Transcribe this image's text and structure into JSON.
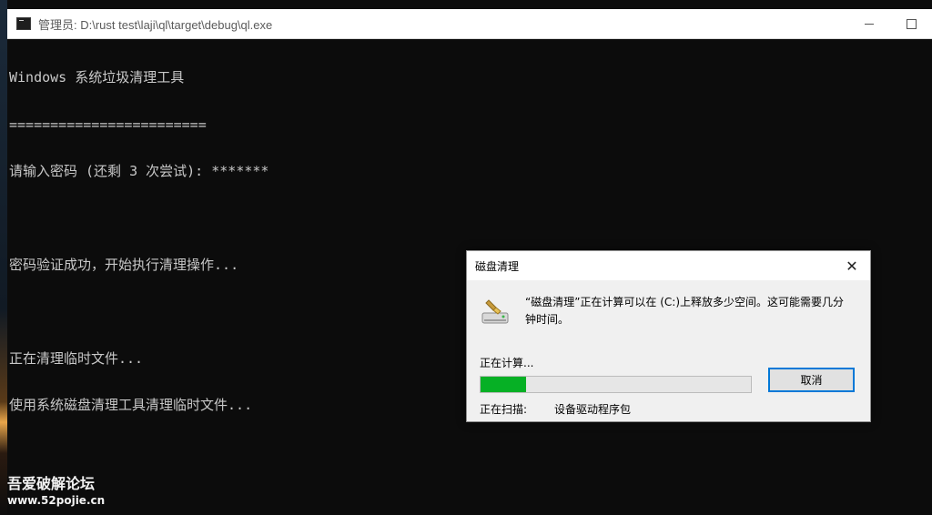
{
  "console": {
    "title": "管理员: D:\\rust test\\laji\\ql\\target\\debug\\ql.exe",
    "lines": [
      "Windows 系统垃圾清理工具",
      "========================",
      "请输入密码 (还剩 3 次尝试): *******",
      "",
      "密码验证成功，开始执行清理操作...",
      "",
      "正在清理临时文件...",
      "使用系统磁盘清理工具清理临时文件..."
    ]
  },
  "dialog": {
    "title": "磁盘清理",
    "close_glyph": "✕",
    "message": "“磁盘清理”正在计算可以在 (C:)上释放多少空间。这可能需要几分钟时间。",
    "status": "正在计算...",
    "progress": 0.17,
    "cancel_label": "取消",
    "scan_label": "正在扫描:",
    "scan_value": "设备驱动程序包",
    "progress_color": "#06b025",
    "focus_color": "#0078d7"
  },
  "watermark": {
    "title": "吾爱破解论坛",
    "url": "www.52pojie.cn"
  },
  "icons": {
    "console_icon": "console-app-icon",
    "dialog_icon": "disk-cleanup-icon"
  }
}
